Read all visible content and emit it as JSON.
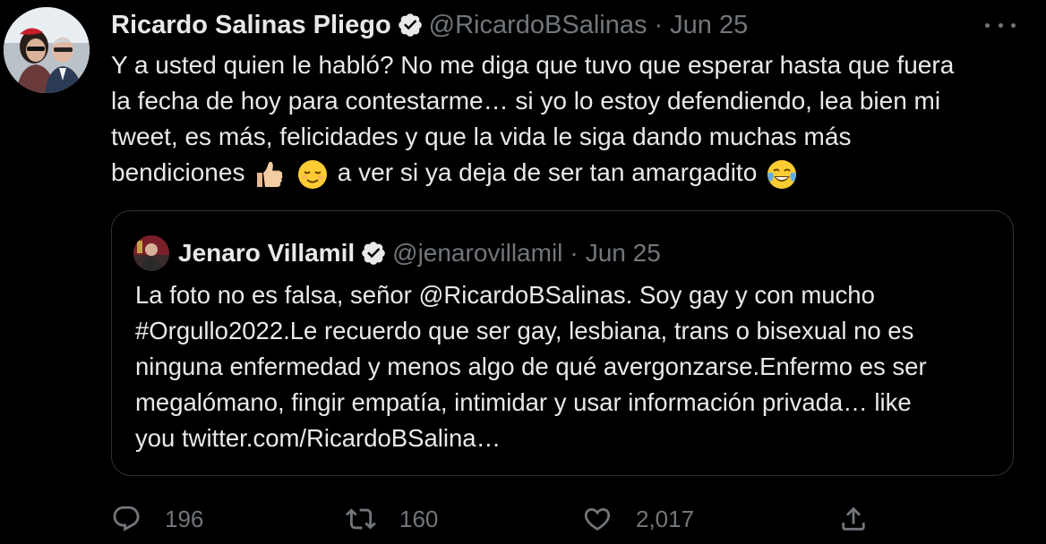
{
  "tweet": {
    "author_name": "Ricardo Salinas Pliego",
    "author_handle": "@RicardoBSalinas",
    "separator": "·",
    "date": "Jun 25",
    "text_lines": [
      "Y a usted quien le habló? No me diga que tuvo que esperar hasta que fuera",
      "la fecha de hoy para contestarme… si yo lo estoy defendiendo, lea bien mi",
      "tweet, es más, felicidades y que la vida le siga dando muchas más"
    ],
    "last_line_start": "bendiciones",
    "last_line_end": "a ver si ya deja de ser tan amargadito",
    "emojis": [
      "thumbs-up-emoji",
      "relieved-face-emoji",
      "tears-of-joy-emoji"
    ]
  },
  "quoted": {
    "author_name": "Jenaro Villamil",
    "author_handle": "@jenarovillamil",
    "separator": "·",
    "date": "Jun 25",
    "text_lines": [
      "La foto no es falsa, señor @RicardoBSalinas. Soy gay y con mucho",
      "#Orgullo2022.Le recuerdo que ser gay, lesbiana, trans o bisexual no es",
      "ninguna enfermedad y menos algo de qué avergonzarse.Enfermo es ser",
      "megalómano, fingir empatía, intimidar y usar información privada… like",
      "you twitter.com/RicardoBSalina…"
    ]
  },
  "actions": {
    "replies": "196",
    "retweets": "160",
    "likes": "2,017"
  },
  "icons": {
    "verified": "verified-badge-icon",
    "more": "more-options-icon",
    "reply": "reply-icon",
    "retweet": "retweet-icon",
    "like": "heart-icon",
    "share": "share-icon"
  },
  "colors": {
    "background": "#000000",
    "text": "#e7e9ea",
    "secondary": "#71767b",
    "border": "#2f3336"
  }
}
